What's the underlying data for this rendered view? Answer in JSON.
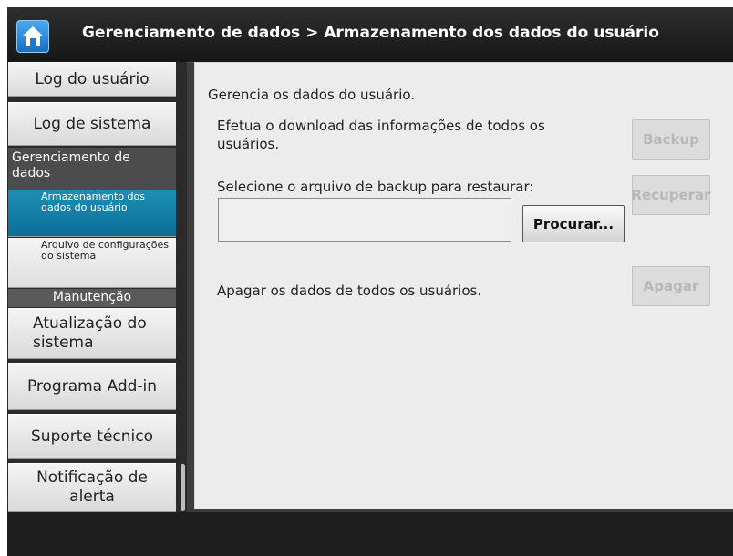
{
  "header": {
    "title": "Gerenciamento de dados > Armazenamento dos dados do usuário",
    "home_icon": "home-icon"
  },
  "sidebar": {
    "items": [
      {
        "label": "Log do usuário"
      },
      {
        "label": "Log de sistema"
      },
      {
        "category": "Gerenciamento de dados"
      },
      {
        "label": "Armazenamento dos dados do usuário",
        "active": true
      },
      {
        "label": "Arquivo de configurações do sistema"
      },
      {
        "category": "Manutenção"
      },
      {
        "label": "Atualização do sistema"
      },
      {
        "label": "Programa Add-in"
      },
      {
        "label": "Suporte técnico"
      },
      {
        "label": "Notificação de alerta"
      }
    ]
  },
  "main": {
    "description": "Gerencia os dados do usuário.",
    "backup_text": "Efetua o download das informações de todos os usuários.",
    "backup_button": "Backup",
    "restore_text": "Selecione o arquivo de backup para restaurar:",
    "file_value": "",
    "browse_button": "Procurar...",
    "restore_button": "Recuperar",
    "delete_text": "Apagar os dados de todos os usuários.",
    "delete_button": "Apagar"
  },
  "colors": {
    "active_nav": "#0b7fa8",
    "header": "#1f1f1f",
    "panel": "#ececec"
  }
}
